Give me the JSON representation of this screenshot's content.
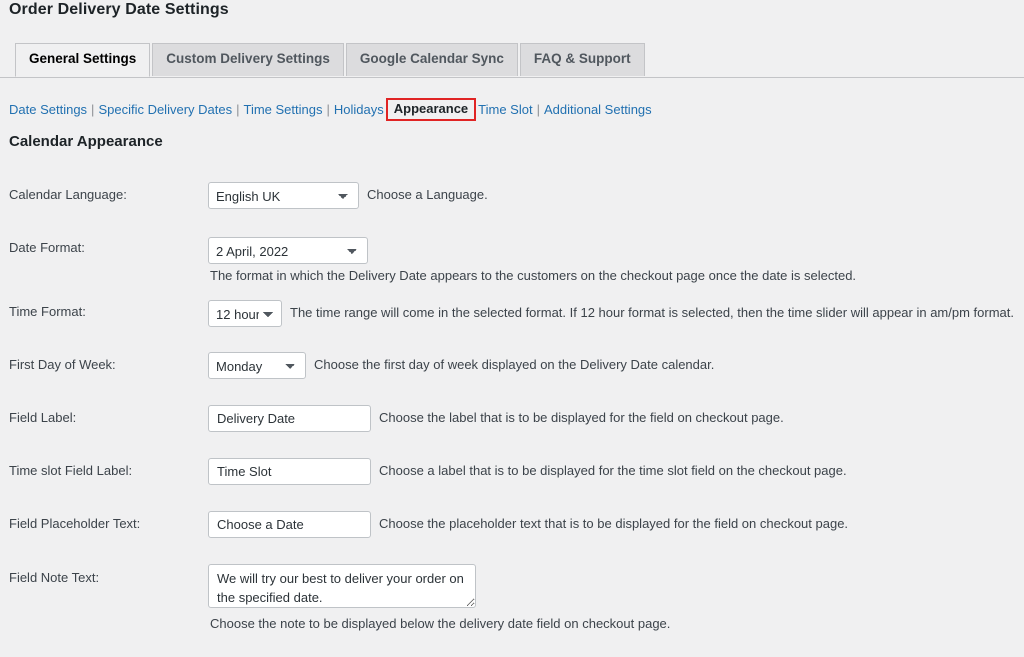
{
  "page": {
    "title": "Order Delivery Date Settings",
    "section_heading": "Calendar Appearance"
  },
  "tabs": [
    {
      "label": "General Settings",
      "active": true
    },
    {
      "label": "Custom Delivery Settings",
      "active": false
    },
    {
      "label": "Google Calendar Sync",
      "active": false
    },
    {
      "label": "FAQ & Support",
      "active": false
    }
  ],
  "subnav": {
    "items": [
      {
        "label": "Date Settings",
        "current": false
      },
      {
        "label": "Specific Delivery Dates",
        "current": false
      },
      {
        "label": "Time Settings",
        "current": false
      },
      {
        "label": "Holidays",
        "current": false
      },
      {
        "label": "Appearance",
        "current": true
      },
      {
        "label": "Time Slot",
        "current": false
      },
      {
        "label": "Additional Settings",
        "current": false
      }
    ],
    "separator": "|",
    "highlight_color": "#e02424",
    "link_color": "#2271b1"
  },
  "fields": {
    "calendar_language": {
      "label": "Calendar Language:",
      "value": "English UK",
      "options": [
        "English UK"
      ],
      "description": "Choose a Language."
    },
    "date_format": {
      "label": "Date Format:",
      "value": "2 April, 2022",
      "options": [
        "2 April, 2022"
      ],
      "description": "The format in which the Delivery Date appears to the customers on the checkout page once the date is selected."
    },
    "time_format": {
      "label": "Time Format:",
      "value": "12 hour",
      "options": [
        "12 hour"
      ],
      "description": "The time range will come in the selected format. If 12 hour format is selected, then the time slider will appear in am/pm format."
    },
    "first_day_of_week": {
      "label": "First Day of Week:",
      "value": "Monday",
      "options": [
        "Monday"
      ],
      "description": "Choose the first day of week displayed on the Delivery Date calendar."
    },
    "field_label": {
      "label": "Field Label:",
      "value": "Delivery Date",
      "placeholder": "",
      "description": "Choose the label that is to be displayed for the field on checkout page."
    },
    "time_slot_field_label": {
      "label": "Time slot Field Label:",
      "value": "Time Slot",
      "placeholder": "",
      "description": "Choose a label that is to be displayed for the time slot field on the checkout page."
    },
    "field_placeholder_text": {
      "label": "Field Placeholder Text:",
      "value": "Choose a Date",
      "placeholder": "",
      "description": "Choose the placeholder text that is to be displayed for the field on checkout page."
    },
    "field_note_text": {
      "label": "Field Note Text:",
      "value": "We will try our best to deliver your order on the specified date.",
      "placeholder": "",
      "description": "Choose the note to be displayed below the delivery date field on checkout page."
    }
  }
}
